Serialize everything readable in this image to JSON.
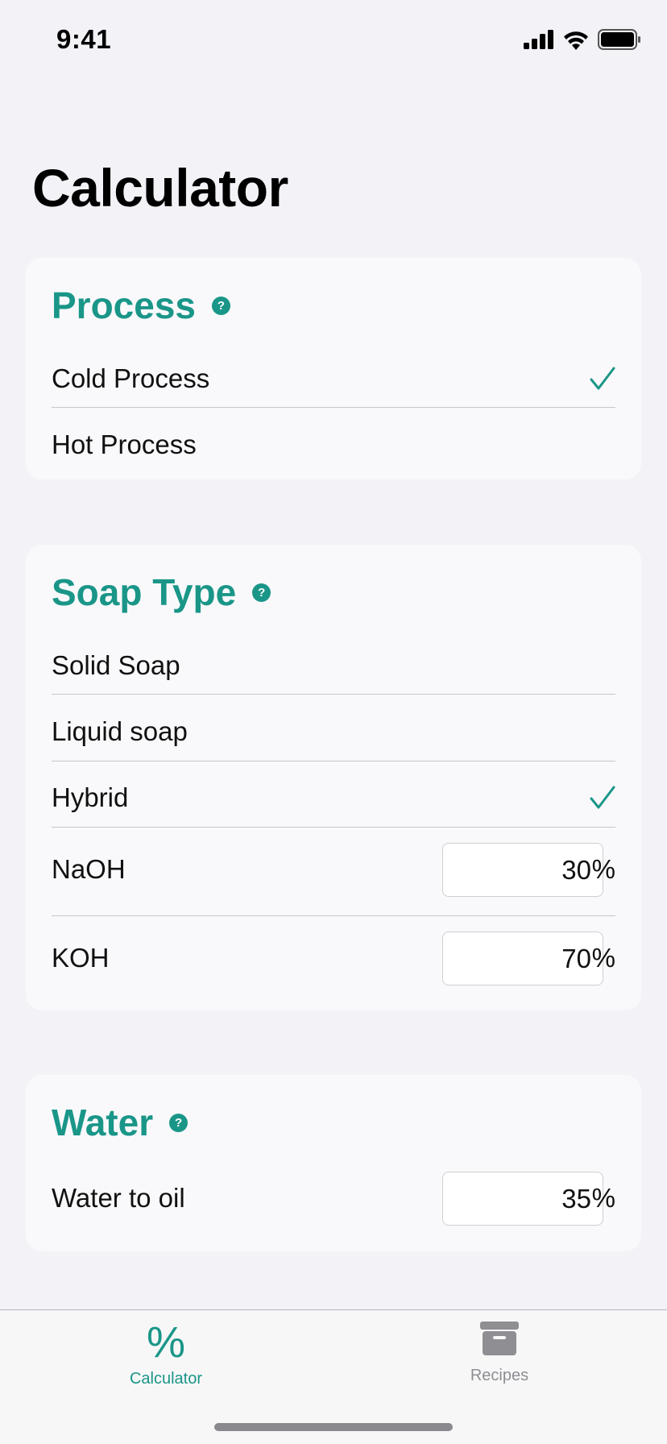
{
  "status_bar": {
    "time": "9:41"
  },
  "page": {
    "title": "Calculator"
  },
  "process": {
    "title": "Process",
    "help": "?",
    "options": [
      {
        "label": "Cold Process",
        "selected": true
      },
      {
        "label": "Hot Process",
        "selected": false
      }
    ]
  },
  "soap_type": {
    "title": "Soap Type",
    "help": "?",
    "options": [
      {
        "label": "Solid Soap",
        "selected": false
      },
      {
        "label": "Liquid soap",
        "selected": false
      },
      {
        "label": "Hybrid",
        "selected": true
      }
    ],
    "naoh": {
      "label": "NaOH",
      "value": "30",
      "unit": "%"
    },
    "koh": {
      "label": "KOH",
      "value": "70",
      "unit": "%"
    }
  },
  "water": {
    "title": "Water",
    "help": "?",
    "water_to_oil": {
      "label": "Water to oil",
      "value": "35",
      "unit": "%"
    }
  },
  "tabs": [
    {
      "label": "Calculator",
      "icon": "percent-icon",
      "active": true,
      "glyph": "%"
    },
    {
      "label": "Recipes",
      "icon": "archivebox-icon",
      "active": false
    }
  ],
  "colors": {
    "accent": "#1a9688",
    "inactive": "#8e8e93",
    "background": "#f2f2f7",
    "card": "#f9f9fb"
  }
}
